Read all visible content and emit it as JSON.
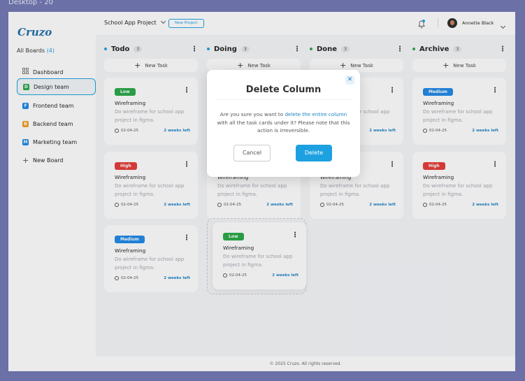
{
  "frame": {
    "label": "Desktop - 20"
  },
  "brand": {
    "logo": "Cruzo",
    "accent": "#1da1e0"
  },
  "sidebar": {
    "all_boards_label": "All Boards",
    "all_boards_count": "(4)",
    "items": [
      {
        "label": "Dashboard",
        "icon": "dashboard-grid-icon"
      },
      {
        "label": "Design team",
        "icon": "D",
        "color": "#27a745",
        "active": true
      },
      {
        "label": "Frontend team",
        "icon": "F",
        "color": "#1e88e5"
      },
      {
        "label": "Backend team",
        "icon": "B",
        "color": "#f0a020"
      },
      {
        "label": "Marketing team",
        "icon": "M",
        "color": "#1e88e5"
      },
      {
        "label": "New Board",
        "icon": "plus-icon"
      }
    ]
  },
  "topbar": {
    "project_name": "School App Project",
    "new_project_label": "New Project",
    "user_name": "Annette Black"
  },
  "columns": [
    {
      "name": "Todo",
      "count": "3",
      "dot_color": "#1da1e0",
      "new_task_label": "New Task"
    },
    {
      "name": "Doing",
      "count": "3",
      "dot_color": "#1da1e0",
      "new_task_label": "New Task"
    },
    {
      "name": "Done",
      "count": "3",
      "dot_color": "#27a745",
      "new_task_label": "New Task"
    },
    {
      "name": "Archive",
      "count": "3",
      "dot_color": "#27a745",
      "new_task_label": "New Task"
    }
  ],
  "cards": {
    "title": "Wireframing",
    "desc": "Do wireframe for school app project in figma.",
    "date": "02-04-25",
    "due": "2 weeks left",
    "tags": {
      "low": {
        "label": "Low",
        "color": "#27a745"
      },
      "high": {
        "label": "High",
        "color": "#e53935"
      },
      "medium": {
        "label": "Medium",
        "color": "#1e88e5"
      }
    }
  },
  "footer": {
    "text": "© 2025 Cruzo. All rights reserved."
  },
  "modal": {
    "title": "Delete Column",
    "msg_part1": "Are you sure you want to ",
    "msg_highlight": "delete the entire column",
    "msg_part2": " with all the task cards under it? Please note that this action is irreversible.",
    "cancel_label": "Cancel",
    "delete_label": "Delete"
  }
}
